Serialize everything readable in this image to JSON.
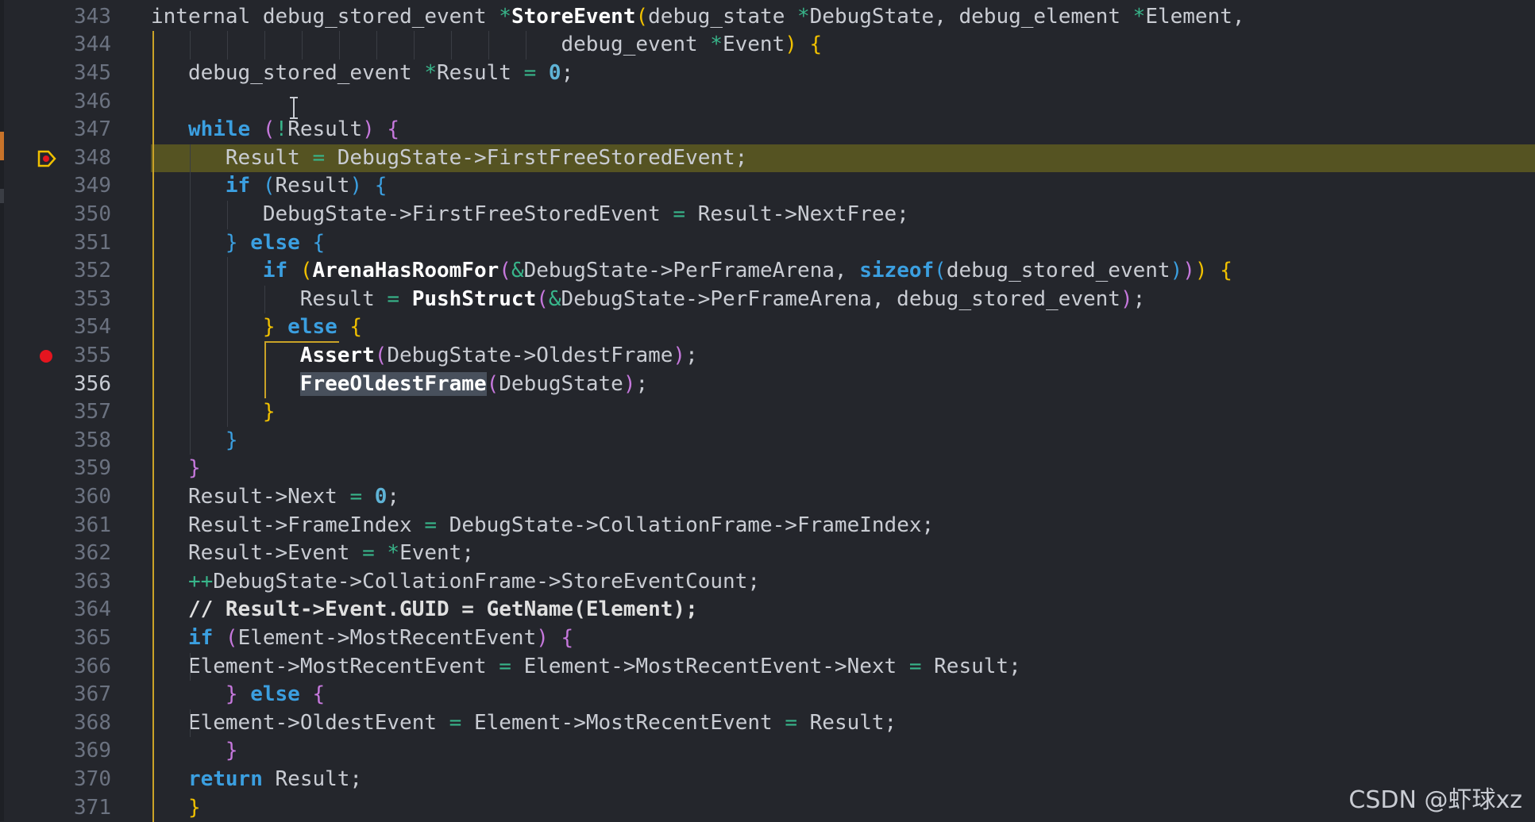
{
  "editor": {
    "current_line": "356",
    "highlighted_line": "348",
    "breakpoint_line": "355",
    "colors": {
      "background": "#24262c",
      "line_highlight": "#555322",
      "keyword": "#3b9fe0",
      "function": "#ffffff",
      "operator": "#38b58a",
      "breakpoint": "#e5151f",
      "bracket_gold": "#f0c000",
      "bracket_magenta": "#c678dd"
    }
  },
  "lines": [
    {
      "n": "343",
      "t": [
        "internal debug_stored_event ",
        "*",
        "StoreEvent",
        "(",
        "debug_state ",
        "*",
        "DebugState, debug_element ",
        "*",
        "Element,"
      ]
    },
    {
      "n": "344",
      "t": [
        "debug_event ",
        "*",
        "Event",
        ")",
        " {"
      ]
    },
    {
      "n": "345",
      "t": [
        "debug_stored_event ",
        "*",
        "Result ",
        "=",
        " ",
        "0",
        ";"
      ]
    },
    {
      "n": "346",
      "t": [
        ""
      ]
    },
    {
      "n": "347",
      "t": [
        "while",
        " ",
        "(",
        "!",
        "Result",
        ")",
        " {"
      ]
    },
    {
      "n": "348",
      "t": [
        "Result ",
        "=",
        " DebugState->FirstFreeStoredEvent;"
      ]
    },
    {
      "n": "349",
      "t": [
        "if",
        " ",
        "(",
        "Result",
        ")",
        " {"
      ]
    },
    {
      "n": "350",
      "t": [
        "DebugState->FirstFreeStoredEvent ",
        "=",
        " Result->NextFree;"
      ]
    },
    {
      "n": "351",
      "t": [
        "}",
        " ",
        "else",
        " {"
      ]
    },
    {
      "n": "352",
      "t": [
        "if",
        " ",
        "(",
        "ArenaHasRoomFor",
        "(",
        "&",
        "DebugState->PerFrameArena, ",
        "sizeof",
        "(",
        "debug_stored_event",
        ")",
        ")",
        ")",
        " {"
      ]
    },
    {
      "n": "353",
      "t": [
        "Result ",
        "=",
        " ",
        "PushStruct",
        "(",
        "&",
        "DebugState->PerFrameArena, debug_stored_event",
        ")",
        ";"
      ]
    },
    {
      "n": "354",
      "t": [
        "}",
        " ",
        "else",
        " {"
      ]
    },
    {
      "n": "355",
      "t": [
        "Assert",
        "(",
        "DebugState->OldestFrame",
        ")",
        ";"
      ]
    },
    {
      "n": "356",
      "t": [
        "FreeOldestFrame",
        "(",
        "DebugState",
        ")",
        ";"
      ]
    },
    {
      "n": "357",
      "t": [
        "}"
      ]
    },
    {
      "n": "358",
      "t": [
        "}"
      ]
    },
    {
      "n": "359",
      "t": [
        "}"
      ]
    },
    {
      "n": "360",
      "t": [
        "Result->Next ",
        "=",
        " ",
        "0",
        ";"
      ]
    },
    {
      "n": "361",
      "t": [
        "Result->FrameIndex ",
        "=",
        " DebugState->CollationFrame->FrameIndex;"
      ]
    },
    {
      "n": "362",
      "t": [
        "Result->Event ",
        "=",
        " ",
        "*",
        "Event;"
      ]
    },
    {
      "n": "363",
      "t": [
        "++",
        "DebugState->CollationFrame->StoreEventCount;"
      ]
    },
    {
      "n": "364",
      "t": [
        "// Result->Event.GUID = GetName(Element);"
      ]
    },
    {
      "n": "365",
      "t": [
        "if",
        " ",
        "(",
        "Element->MostRecentEvent",
        ")",
        " {"
      ]
    },
    {
      "n": "366",
      "t": [
        "Element->MostRecentEvent ",
        "=",
        " Element->MostRecentEvent->Next ",
        "=",
        " Result;"
      ]
    },
    {
      "n": "367",
      "t": [
        "}",
        " ",
        "else",
        " {"
      ]
    },
    {
      "n": "368",
      "t": [
        "Element->OldestEvent ",
        "=",
        " Element->MostRecentEvent ",
        "=",
        " Result;"
      ]
    },
    {
      "n": "369",
      "t": [
        "}"
      ]
    },
    {
      "n": "370",
      "t": [
        "return",
        " Result;"
      ]
    },
    {
      "n": "371",
      "t": [
        "}"
      ]
    }
  ],
  "watermark": "CSDN @虾球xz"
}
